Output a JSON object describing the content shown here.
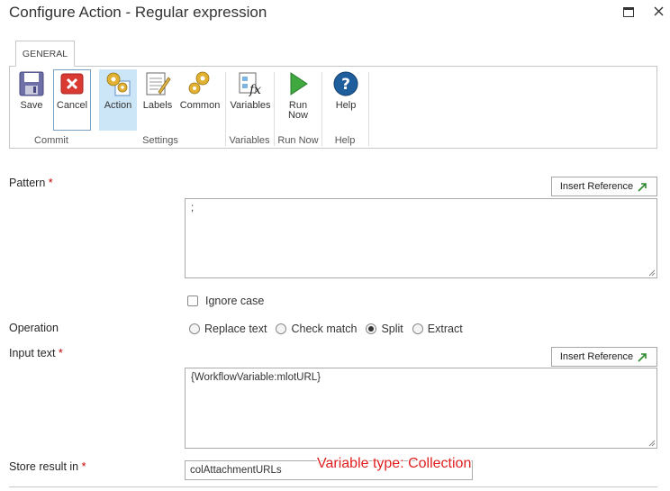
{
  "dialog": {
    "title": "Configure Action - Regular expression"
  },
  "ribbon": {
    "tab": "GENERAL",
    "buttons": {
      "save": "Save",
      "cancel": "Cancel",
      "action": "Action",
      "labels": "Labels",
      "common": "Common",
      "variables": "Variables",
      "run_now_line1": "Run",
      "run_now_line2": "Now",
      "help": "Help"
    },
    "groups": {
      "commit": "Commit",
      "settings": "Settings",
      "variables": "Variables",
      "run_now": "Run Now",
      "help": "Help"
    },
    "icons": [
      "save-icon",
      "cancel-icon",
      "action-gear-icon",
      "labels-icon",
      "common-gear-icon",
      "variables-fx-icon",
      "run-now-play-icon",
      "help-icon"
    ]
  },
  "form": {
    "pattern_label": "Pattern",
    "required_marker": "*",
    "insert_reference": "Insert Reference",
    "pattern_value": ";",
    "ignore_case_label": "Ignore case",
    "ignore_case_checked": false,
    "operation_label": "Operation",
    "operation_options": {
      "replace": "Replace text",
      "check": "Check match",
      "split": "Split",
      "extract": "Extract"
    },
    "operation_selected": "Split",
    "input_text_label": "Input text",
    "input_text_value": "{WorkflowVariable:mlotURL}",
    "store_result_label": "Store result in",
    "store_result_value": "colAttachmentURLs"
  },
  "annotation": {
    "text": "Variable type: Collection",
    "color": "#e02020"
  },
  "colors": {
    "selected_button_bg": "#cde6f7",
    "required": "#c00000",
    "border": "#c6c6c6"
  }
}
